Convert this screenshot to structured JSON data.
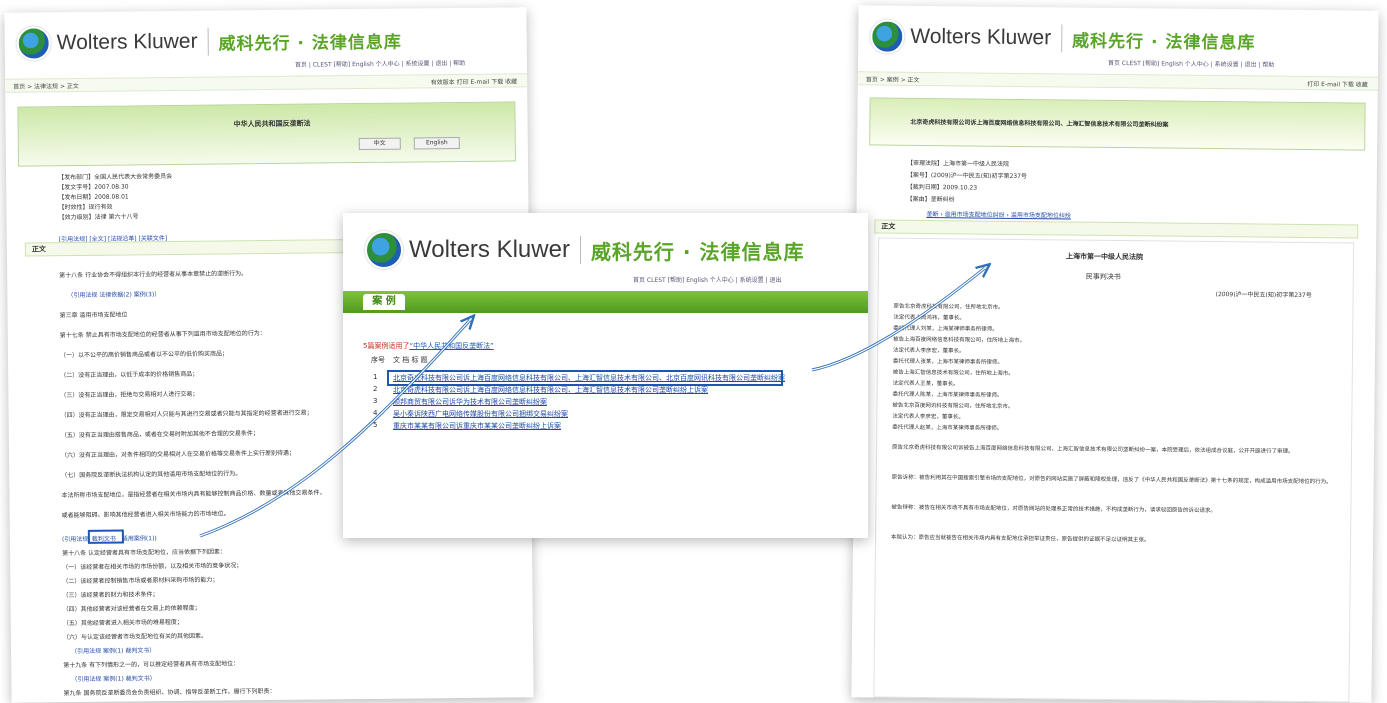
{
  "brand": {
    "name": "Wolters Kluwer",
    "cn": "威科先行 · 法律信息库"
  },
  "left": {
    "top_links": "首页 | CLEST  [帮助] English  个人中心 | 系统设置 | 退出 | 帮助",
    "breadcrumb": "首页 > 法律法规 > 正文",
    "toolbar": "有效版本  打印  E-mail  下载  收藏",
    "title": "中华人民共和国反垄断法",
    "btn_a": "中文",
    "btn_b": "English",
    "meta": [
      "【发布部门】全国人民代表大会常务委员会",
      "【发文字号】2007.08.30",
      "【发布日期】2008.08.01",
      "【时效性】现行有效",
      "【效力级别】法律 第六十八号"
    ],
    "meta_links": "[引用法规] [全文] [法规沿革] [关联文件]",
    "section": "正文",
    "body": [
      "第十八条 行业协会不得组织本行业的经营者从事本章禁止的垄断行为。",
      "（引用法规 法律依据(2) 案例(3)）",
      "第三章 滥用市场支配地位",
      "第十七条 禁止具有市场支配地位的经营者从事下列滥用市场支配地位的行为：",
      "（一）以不公平的高价销售商品或者以不公平的低价购买商品；",
      "（二）没有正当理由，以低于成本的价格销售商品；",
      "（三）没有正当理由，拒绝与交易相对人进行交易；",
      "（四）没有正当理由，限定交易相对人只能与其进行交易或者只能与其指定的经营者进行交易；",
      "（五）没有正当理由搭售商品，或者在交易时附加其他不合理的交易条件；",
      "（六）没有正当理由，对条件相同的交易相对人在交易价格等交易条件上实行差别待遇；",
      "（七）国务院反垄断执法机构认定的其他滥用市场支配地位的行为。",
      "本法所称市场支配地位，是指经营者在相关市场内具有能够控制商品价格、数量或者其他交易条件，",
      "或者能够阻碍、影响其他经营者进入相关市场能力的市场地位。"
    ],
    "links_row": [
      "(引用法规",
      "裁判文书",
      "适用案例(1))"
    ],
    "body2": [
      "第十八条 认定经营者具有市场支配地位，应当依据下列因素：",
      "（一）该经营者在相关市场的市场份额，以及相关市场的竞争状况；",
      "（二）该经营者控制销售市场或者原材料采购市场的能力；",
      "（三）该经营者的财力和技术条件；",
      "（四）其他经营者对该经营者在交易上的依赖程度；",
      "（五）其他经营者进入相关市场的难易程度；",
      "（六）与认定该经营者市场支配地位有关的其他因素。",
      "（引用法规 案例(1) 裁判文书）",
      "第十九条 有下列情形之一的，可以推定经营者具有市场支配地位：",
      "（引用法规 案例(1) 裁判文书）",
      "第九条 国务院反垄断委员会负责组织、协调、指导反垄断工作，履行下列职责："
    ]
  },
  "middle": {
    "top_links": "首页 CLEST  [帮助] English  个人中心 | 系统设置 | 退出",
    "tab": "案 例",
    "result_prefix": "5篇案例适用了",
    "result_law": "“中华人民共和国反垄断法”",
    "col_no": "序号",
    "col_title": "文 档 标 题",
    "results": [
      {
        "no": "1",
        "title": "北京奇虎科技有限公司诉上海百度网络信息科技有限公司、上海汇智信息技术有限公司、北京百度网讯科技有限公司垄断纠纷案"
      },
      {
        "no": "2",
        "title": "北京奇虎科技有限公司诉上海百度网络信息科技有限公司、上海汇智信息技术有限公司垄断纠纷上诉案"
      },
      {
        "no": "3",
        "title": "顺邦商贸有限公司诉华为技术有限公司垄断纠纷案"
      },
      {
        "no": "4",
        "title": "吴小秦诉陕西广电网络传媒股份有限公司捆绑交易纠纷案"
      },
      {
        "no": "5",
        "title": "重庆市某某有限公司诉重庆市某某公司垄断纠纷上诉案"
      }
    ]
  },
  "right": {
    "top_links": "首页 CLEST  [帮助] English  个人中心 | 系统设置 | 退出 | 帮助",
    "breadcrumb": "首页 > 案例 > 正文",
    "toolbar": "打印  E-mail  下载  收藏",
    "title": "北京奇虎科技有限公司诉上海百度网络信息科技有限公司、上海汇智信息技术有限公司垄断纠纷案",
    "meta": [
      "【审理法院】上海市第一中级人民法院",
      "【案号】(2009)沪一中民五(知)初字第237号",
      "【裁判日期】2009.10.23",
      "【案由】垄断纠纷"
    ],
    "meta_links": "垄断 › 滥用市场支配地位纠纷 › 滥用市场支配地位纠纷",
    "section": "正文",
    "court": "上海市第一中级人民法院",
    "doc_type": "民事判决书",
    "case_no": "(2009)沪一中民五(知)初字第237号",
    "body": [
      "原告北京奇虎科技有限公司，住所地北京市。",
      "法定代表人周鸿祎，董事长。",
      "委托代理人刘某，上海某律师事务所律师。",
      "被告上海百度网络信息科技有限公司，住所地上海市。",
      "法定代表人李彦宏，董事长。",
      "委托代理人张某，上海市某律师事务所律师。",
      "被告上海汇智信息技术有限公司，住所地上海市。",
      "法定代表人王某，董事长。",
      "委托代理人陈某，上海市某律师事务所律师。",
      "被告北京百度网讯科技有限公司，住所地北京市。",
      "法定代表人李彦宏，董事长。",
      "委托代理人赵某，上海市某律师事务所律师。",
      "原告北京奇虎科技有限公司诉被告上海百度网络信息科技有限公司、上海汇智信息技术有限公司垄断纠纷一案，本院受理后，依法组成合议庭，公开开庭进行了审理。",
      "原告诉称：被告利用其在中国搜索引擎市场的支配地位，对原告的网站实施了屏蔽和降权处理，违反了《中华人民共和国反垄断法》第十七条的规定，构成滥用市场支配地位的行为。",
      "被告辩称：被告在相关市场不具有市场支配地位，对原告网站的处理系正常的技术措施，不构成垄断行为，请求驳回原告的诉讼请求。",
      "本院认为：原告应当就被告在相关市场内具有支配地位承担举证责任，原告提供的证据不足以证明其主张。"
    ]
  }
}
